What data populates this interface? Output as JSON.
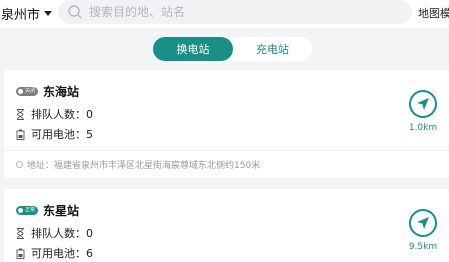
{
  "header": {
    "city": "泉州市",
    "search_placeholder": "搜索目的地、站名",
    "map_label": "地图模"
  },
  "tabs": [
    {
      "label": "换电站",
      "active": true
    },
    {
      "label": "充电站",
      "active": false
    }
  ],
  "stations": [
    {
      "status": "关闭",
      "name": "东海站",
      "queue_label": "排队人数：",
      "queue_value": "0",
      "battery_label": "可用电池：",
      "battery_value": "5",
      "distance": "1.0km",
      "address": "地址：福建省泉州市丰泽区北星街海宸尊域东北侧约150米"
    },
    {
      "status": "正常",
      "name": "东星站",
      "queue_label": "排队人数：",
      "queue_value": "0",
      "battery_label": "可用电池：",
      "battery_value": "6",
      "distance": "9.5km"
    }
  ],
  "colors": {
    "accent": "#1a8f88",
    "closed_badge": "#7d7d7d"
  }
}
